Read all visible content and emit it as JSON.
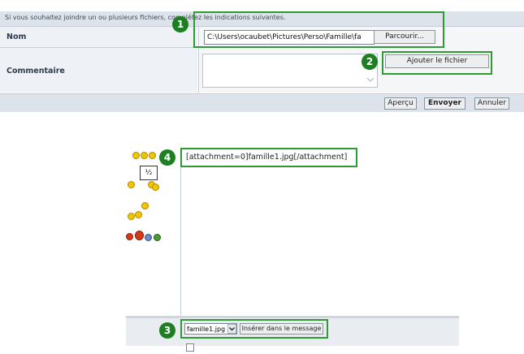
{
  "form": {
    "hint": "Si vous souhaitez joindre un ou plusieurs fichiers, complétez les indications suivantes.",
    "nom_label": "Nom",
    "commentaire_label": "Commentaire",
    "file_path_value": "C:\\Users\\ocaubet\\Pictures\\Perso\\Famille\\fa",
    "browse_label": "Parcourir...",
    "add_file_label": "Ajouter le fichier",
    "comment_value": "",
    "buttons": {
      "preview": "Aperçu",
      "send": "Envoyer",
      "cancel": "Annuler"
    }
  },
  "editor": {
    "message_text": "[attachment=0]famille1.jpg[/attachment]",
    "attachment_select_value": "famille1.jpg",
    "insert_label": "Insérer dans le message"
  },
  "callouts": [
    "1",
    "2",
    "3",
    "4"
  ],
  "colors": {
    "callout_green": "#2e9a32",
    "badge_green": "#1d7f22",
    "panel_header": "#dde3ea"
  }
}
